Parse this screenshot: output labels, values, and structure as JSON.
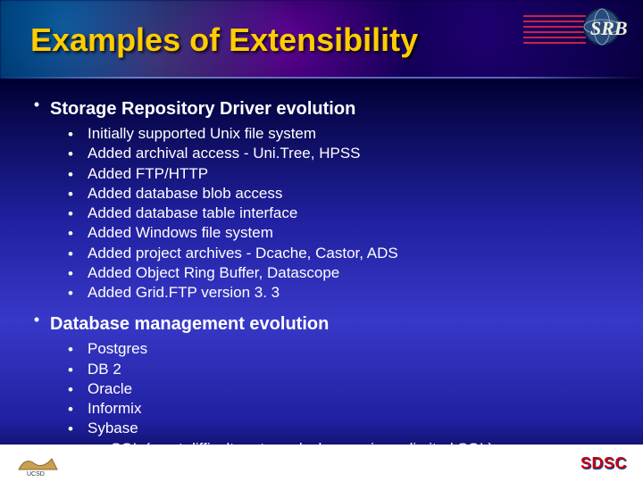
{
  "title": "Examples of Extensibility",
  "sections": [
    {
      "heading": "Storage Repository Driver evolution",
      "items": [
        "Initially supported Unix file system",
        "Added archival access - Uni.Tree, HPSS",
        "Added FTP/HTTP",
        "Added database blob access",
        "Added database table interface",
        "Added Windows file system",
        "Added project archives - Dcache, Castor, ADS",
        "Added Object Ring Buffer, Datascope",
        "Added Grid.FTP version 3. 3"
      ]
    },
    {
      "heading": "Database management evolution",
      "items": [
        "Postgres",
        "DB 2",
        "Oracle",
        "Informix",
        "Sybase",
        "my.SQL (most difficult port - no locks, no views, limited SQL)"
      ]
    }
  ],
  "footer": {
    "left_logo": "UCSD",
    "right_logo": "SDSC"
  },
  "header_logo": "SRB"
}
